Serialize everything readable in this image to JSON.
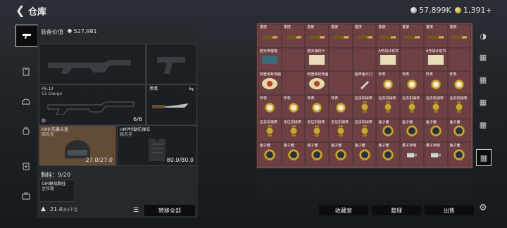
{
  "header": {
    "back_icon": "chevron-left-icon",
    "title": "仓库",
    "silver_amount": "57,899K",
    "gold_amount": "1,391+"
  },
  "sidebar": {
    "items": [
      {
        "icon": "gun-icon",
        "active": true
      },
      {
        "icon": "armor-vest-icon",
        "active": false
      },
      {
        "icon": "helmet-icon",
        "active": false
      },
      {
        "icon": "backpack-icon",
        "active": false
      },
      {
        "icon": "medkit-icon",
        "active": false
      },
      {
        "icon": "toolbox-icon",
        "active": false
      }
    ]
  },
  "loadout": {
    "label": "装备价值",
    "value": "527,981",
    "primary_weapon": {
      "name": "FS-12",
      "sub": "12 Gauge",
      "count": "6/6"
    },
    "melee": {
      "name": "黑鹰"
    },
    "helmet": {
      "name": "H09 防暴头盔",
      "sub": "暗天尧",
      "durability": "27.0/27.0"
    },
    "armor": {
      "name": "HMP特勤防弹衣",
      "sub": "暗天尧",
      "durability": "80.0/80.0"
    },
    "chest_label": "胸挂：",
    "chest_value": "9/20",
    "rig_name": "GIR野战胸挂",
    "rig_sub": "金铁路",
    "weight_value": "21.4",
    "weight_max": "/84千克",
    "transfer_all": "转移全部"
  },
  "stash": {
    "rows": [
      [
        "香槟",
        "香槟",
        "香槟",
        "香槟",
        "香槟",
        "香槟",
        "香槟",
        "香槟",
        "香槟"
      ],
      [
        "航天传输物",
        "",
        "航天海纹卡",
        "",
        "",
        "A作战计划书",
        "",
        "A作战计划书",
        ""
      ],
      [
        "阿登纳耳饰面",
        "",
        "阿登纳耳饰面",
        "",
        "超声速炎门",
        "怀表",
        "怀表",
        "怀表",
        "怀表"
      ],
      [
        "怀表",
        "怀表",
        "怀表",
        "怀表",
        "名贵机械表",
        "名贵机械表",
        "名贵机械表",
        "名贵机械表",
        "名贵机械表"
      ],
      [
        "名贵机械表",
        "定位机械表",
        "定位机械表",
        "定位机械表",
        "名贵机械表",
        "鱼子酱",
        "鱼子酱",
        "鱼子酱",
        "鱼子酱"
      ],
      [
        "鱼子酱",
        "鱼子酱",
        "鱼子酱",
        "鱼子酱",
        "鱼子酱",
        "鱼子酱",
        "量子存储",
        "量子存储",
        "鱼子酱"
      ]
    ]
  },
  "footer": {
    "collect": "收藏室",
    "organize": "整理",
    "sell": "出售"
  },
  "right_icons": [
    "stash-tab-1-icon",
    "stash-tab-2-icon",
    "stash-tab-3-icon",
    "stash-tab-4-icon",
    "stash-tab-5-icon",
    "stash-tab-6-icon",
    "settings-icon"
  ],
  "colors": {
    "stash_cell": "#6e3f43",
    "gold": "#c9a43a",
    "panel": "#262a2f"
  }
}
